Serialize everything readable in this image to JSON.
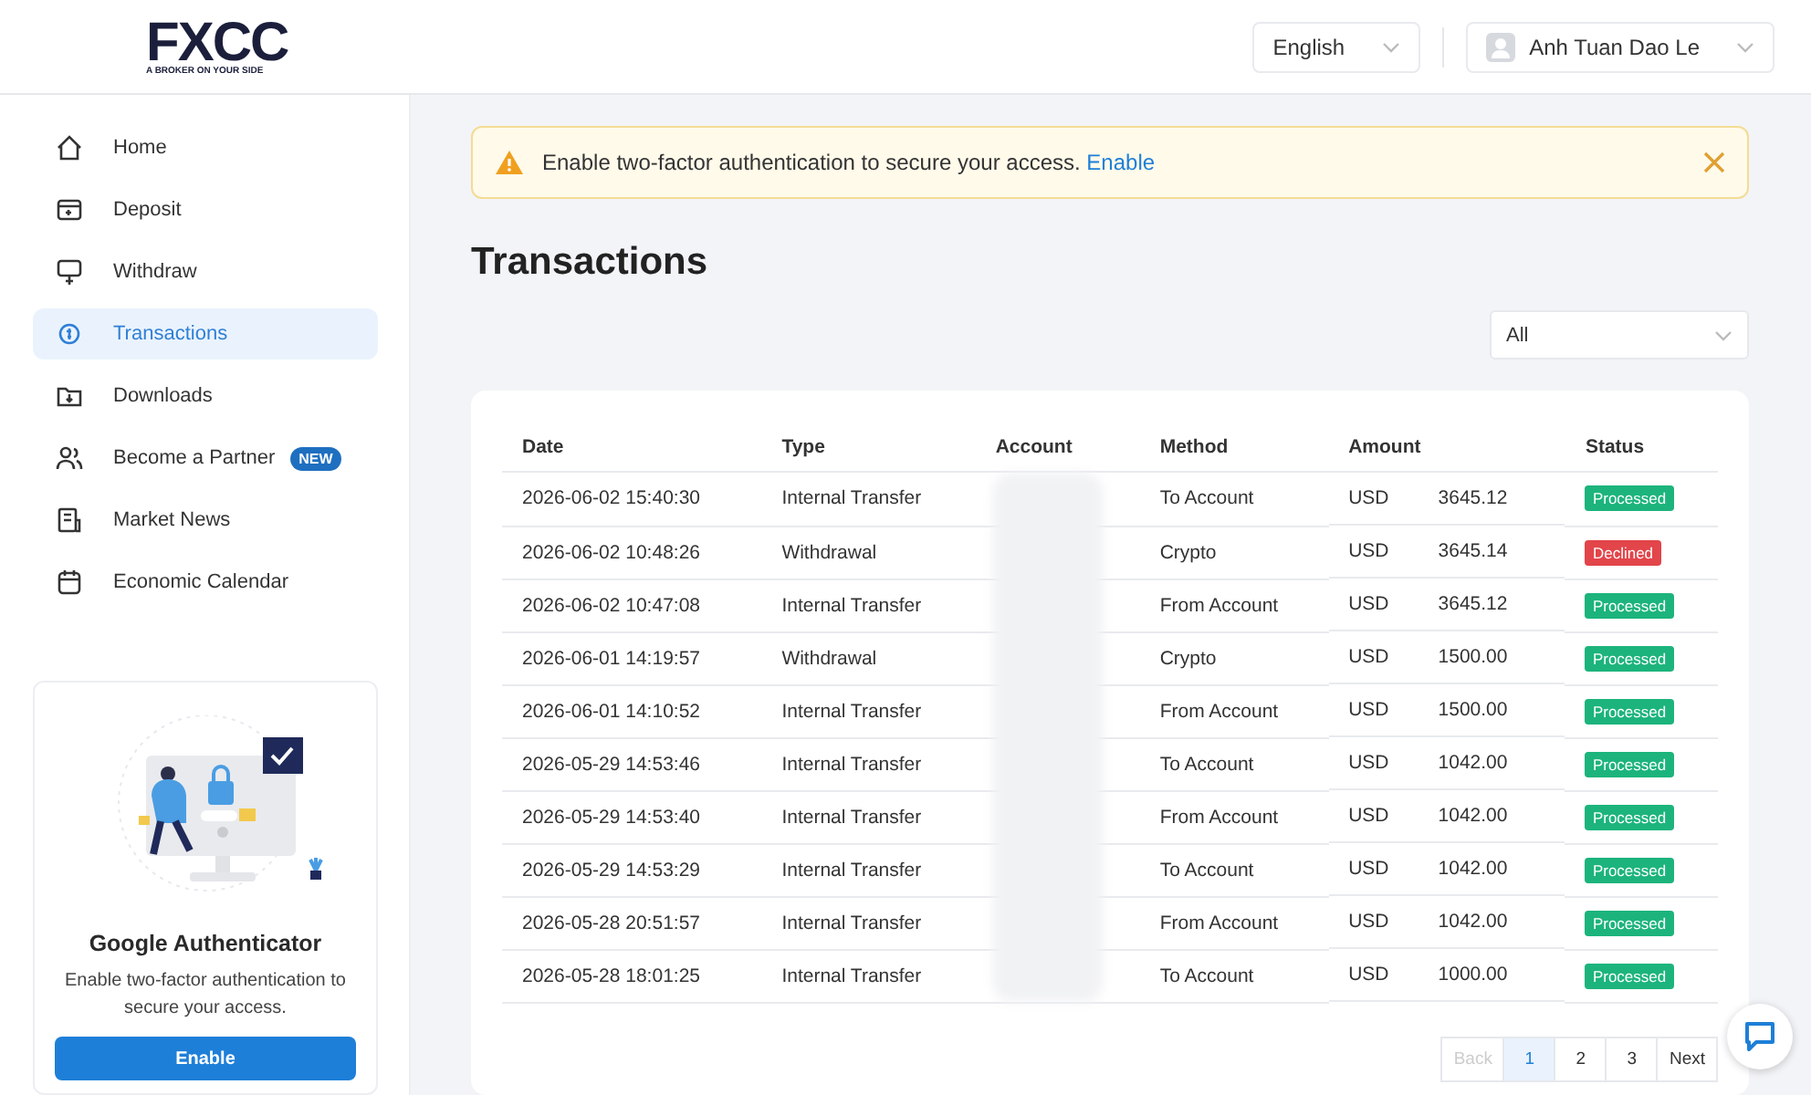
{
  "logo": {
    "brand": "FXCC",
    "tagline": "A BROKER ON YOUR SIDE"
  },
  "header": {
    "language": "English",
    "user": "Anh Tuan Dao Le"
  },
  "sidebar": {
    "items": [
      {
        "label": "Home",
        "kind": "home",
        "selected": false
      },
      {
        "label": "Deposit",
        "kind": "deposit",
        "selected": false
      },
      {
        "label": "Withdraw",
        "kind": "withdraw",
        "selected": false
      },
      {
        "label": "Transactions",
        "kind": "transactions",
        "selected": true
      },
      {
        "label": "Downloads",
        "kind": "downloads",
        "selected": false
      },
      {
        "label": "Become a Partner",
        "kind": "partner",
        "selected": false,
        "badge": "NEW"
      },
      {
        "label": "Market News",
        "kind": "news",
        "selected": false
      },
      {
        "label": "Economic Calendar",
        "kind": "calendar",
        "selected": false
      }
    ],
    "promo": {
      "title": "Google Authenticator",
      "text": "Enable two-factor authentication to secure your access.",
      "button": "Enable"
    }
  },
  "alert": {
    "text": "Enable two-factor authentication to secure your access.",
    "link": "Enable"
  },
  "page_title": "Transactions",
  "filter": {
    "value": "All"
  },
  "table": {
    "columns": [
      "Date",
      "Type",
      "Account",
      "Method",
      "Amount",
      "Status"
    ],
    "rows": [
      {
        "date": "2026-06-02 15:40:30",
        "type": "Internal Transfer",
        "method": "To Account",
        "currency": "USD",
        "amount": "3645.12",
        "status": {
          "label": "Processed",
          "kind": "processed"
        }
      },
      {
        "date": "2026-06-02 10:48:26",
        "type": "Withdrawal",
        "method": "Crypto",
        "currency": "USD",
        "amount": "3645.14",
        "status": {
          "label": "Declined",
          "kind": "declined"
        }
      },
      {
        "date": "2026-06-02 10:47:08",
        "type": "Internal Transfer",
        "method": "From Account",
        "currency": "USD",
        "amount": "3645.12",
        "status": {
          "label": "Processed",
          "kind": "processed"
        }
      },
      {
        "date": "2026-06-01 14:19:57",
        "type": "Withdrawal",
        "method": "Crypto",
        "currency": "USD",
        "amount": "1500.00",
        "status": {
          "label": "Processed",
          "kind": "processed"
        }
      },
      {
        "date": "2026-06-01 14:10:52",
        "type": "Internal Transfer",
        "method": "From Account",
        "currency": "USD",
        "amount": "1500.00",
        "status": {
          "label": "Processed",
          "kind": "processed"
        }
      },
      {
        "date": "2026-05-29 14:53:46",
        "type": "Internal Transfer",
        "method": "To Account",
        "currency": "USD",
        "amount": "1042.00",
        "status": {
          "label": "Processed",
          "kind": "processed"
        }
      },
      {
        "date": "2026-05-29 14:53:40",
        "type": "Internal Transfer",
        "method": "From Account",
        "currency": "USD",
        "amount": "1042.00",
        "status": {
          "label": "Processed",
          "kind": "processed"
        }
      },
      {
        "date": "2026-05-29 14:53:29",
        "type": "Internal Transfer",
        "method": "To Account",
        "currency": "USD",
        "amount": "1042.00",
        "status": {
          "label": "Processed",
          "kind": "processed"
        }
      },
      {
        "date": "2026-05-28 20:51:57",
        "type": "Internal Transfer",
        "method": "From Account",
        "currency": "USD",
        "amount": "1042.00",
        "status": {
          "label": "Processed",
          "kind": "processed"
        }
      },
      {
        "date": "2026-05-28 18:01:25",
        "type": "Internal Transfer",
        "method": "To Account",
        "currency": "USD",
        "amount": "1000.00",
        "status": {
          "label": "Processed",
          "kind": "processed"
        }
      }
    ]
  },
  "pagination": [
    {
      "label": "Back",
      "disabled": true,
      "selected": false
    },
    {
      "label": "1",
      "disabled": false,
      "selected": true
    },
    {
      "label": "2",
      "disabled": false,
      "selected": false
    },
    {
      "label": "3",
      "disabled": false,
      "selected": false
    },
    {
      "label": "Next",
      "disabled": false,
      "selected": false
    }
  ]
}
